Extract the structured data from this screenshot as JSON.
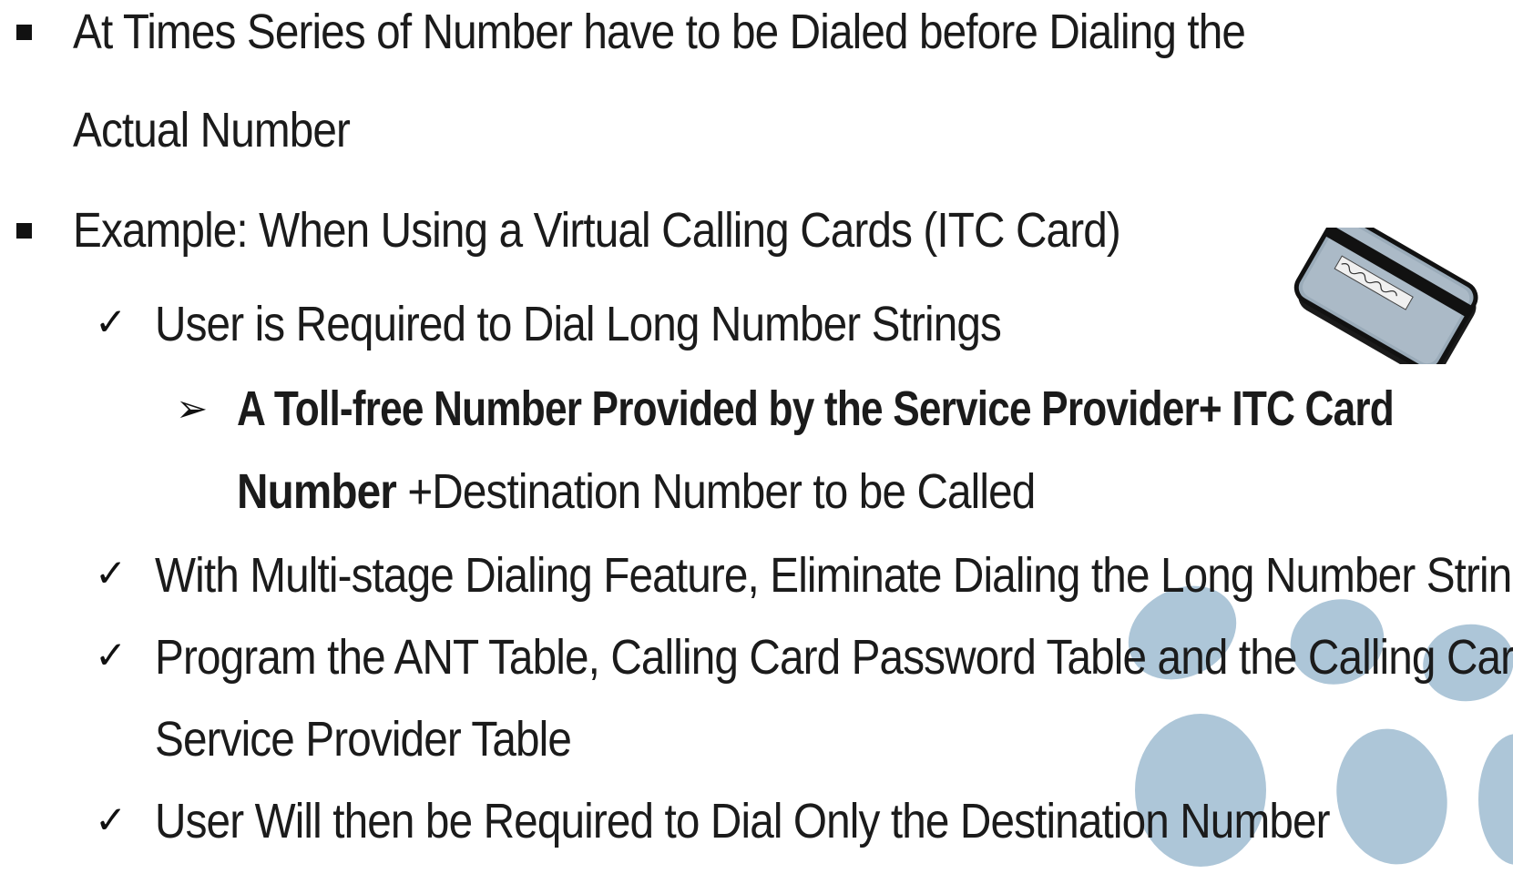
{
  "slide": {
    "bullets": [
      {
        "lines": [
          "At Times Series of Number have to be Dialed before Dialing the",
          "Actual Number"
        ]
      },
      {
        "text": "Example: When Using a Virtual Calling Cards (ITC Card)"
      }
    ],
    "checks": [
      {
        "text": "User is Required to Dial Long Number Strings"
      },
      {
        "text": "With Multi-stage Dialing Feature, Eliminate Dialing the Long Number Strings"
      },
      {
        "lines": [
          "Program the ANT Table, Calling Card Password Table and the  Calling Card",
          "Service Provider Table"
        ]
      },
      {
        "text": "User Will then be Required to Dial Only the Destination Number"
      }
    ],
    "sub_bullet": {
      "line1_bold": "A Toll-free Number Provided by the Service Provider+ ITC Card",
      "line2_bold": "Number",
      "line2_regular": " +Destination Number to be Called"
    }
  },
  "icons": {
    "bullet": "square-bullet-icon",
    "check": "checkmark-icon",
    "arrow": "arrowhead-bullet-icon",
    "card": "calling-card-icon"
  },
  "colors": {
    "text": "#1b1b1b",
    "decor_dots": "#a9c3d6",
    "card_body": "#9aabb9"
  }
}
